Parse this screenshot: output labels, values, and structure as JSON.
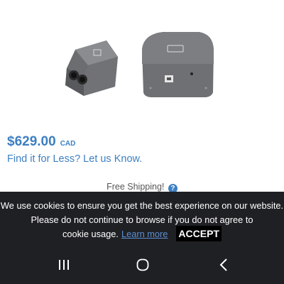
{
  "product": {
    "price": "$629.00",
    "currency": "CAD",
    "find_less": "Find it for Less? Let us Know.",
    "shipping": "Free Shipping!",
    "shipping_icon": "info-icon",
    "image_icon": "dmx-interface-device"
  },
  "cookie": {
    "message": "We use cookies to ensure you get the best experience on our website. Please do not continue to browse if you do not agree to",
    "message_end": "cookie usage.",
    "learn_more": "Learn more",
    "accept": "ACCEPT"
  },
  "nav": {
    "buttons": [
      "recent-apps-icon",
      "home-icon",
      "back-icon"
    ]
  },
  "colors": {
    "accent": "#3d7fc1",
    "banner_bg": "#1f2023",
    "link": "#5b8fd6"
  }
}
